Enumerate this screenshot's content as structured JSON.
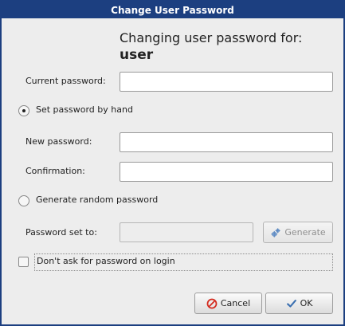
{
  "window": {
    "title": "Change User Password"
  },
  "header": {
    "line1": "Changing user password for:",
    "username": "user"
  },
  "current_password": {
    "label": "Current password:",
    "value": ""
  },
  "mode": {
    "by_hand_label": "Set password by hand",
    "random_label": "Generate random password",
    "selected": "by_hand"
  },
  "new_password": {
    "label": "New password:",
    "value": ""
  },
  "confirmation": {
    "label": "Confirmation:",
    "value": ""
  },
  "password_set_to": {
    "label": "Password set to:",
    "value": ""
  },
  "generate_button": {
    "label": "Generate",
    "icon": "gear-icon"
  },
  "dont_ask": {
    "label": "Don't ask for password on login",
    "checked": false
  },
  "buttons": {
    "cancel": {
      "label": "Cancel",
      "icon": "cancel-icon"
    },
    "ok": {
      "label": "OK",
      "icon": "checkmark-icon"
    }
  }
}
